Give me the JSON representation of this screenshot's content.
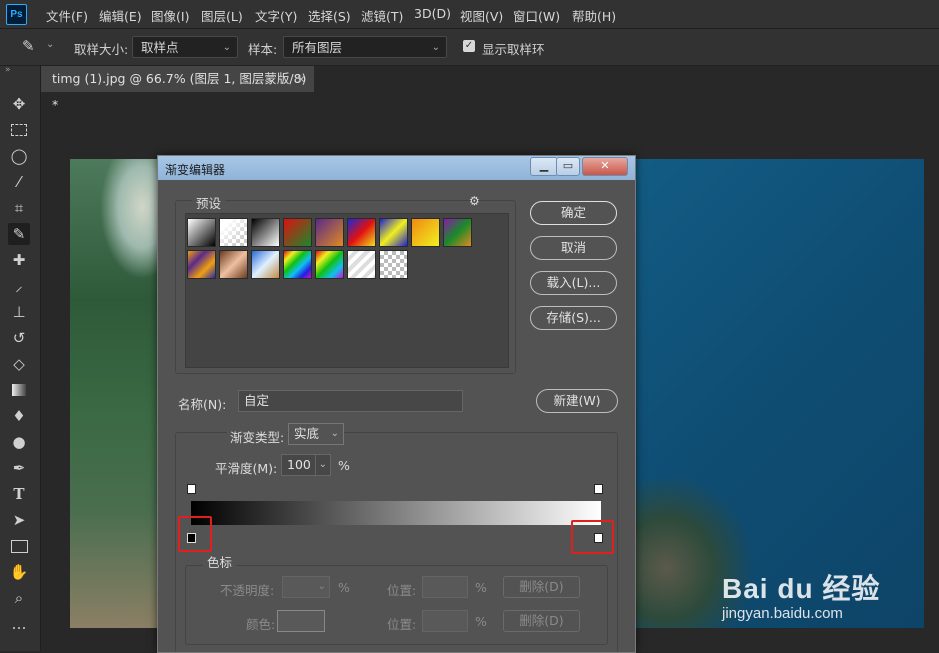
{
  "menu": {
    "logo": "Ps",
    "items": [
      "文件(F)",
      "编辑(E)",
      "图像(I)",
      "图层(L)",
      "文字(Y)",
      "选择(S)",
      "滤镜(T)",
      "3D(D)",
      "视图(V)",
      "窗口(W)",
      "帮助(H)"
    ]
  },
  "options": {
    "sample_size_label": "取样大小:",
    "sample_size_value": "取样点",
    "sample_label": "样本:",
    "sample_value": "所有图层",
    "show_ring_label": "显示取样环",
    "show_ring_checked": true
  },
  "tools": [
    "move-tool",
    "marquee-tool",
    "lasso-tool",
    "magic-wand-tool",
    "crop-tool",
    "eyedropper-tool",
    "healing-brush-tool",
    "brush-tool",
    "stamp-tool",
    "history-brush-tool",
    "eraser-tool",
    "gradient-tool",
    "blur-tool",
    "dodge-tool",
    "pen-tool",
    "type-tool",
    "path-select-tool",
    "rectangle-tool",
    "hand-tool",
    "zoom-tool",
    "more-tools"
  ],
  "active_tool": "eyedropper-tool",
  "document": {
    "tab_title": "timg (1).jpg @ 66.7% (图层 1, 图层蒙版/8) *",
    "close": "×"
  },
  "dialog": {
    "title": "渐变编辑器",
    "presets_label": "预设",
    "buttons": {
      "ok": "确定",
      "cancel": "取消",
      "load": "载入(L)...",
      "save": "存储(S)...",
      "new": "新建(W)"
    },
    "name_label": "名称(N):",
    "name_value": "自定",
    "gradient_type_label": "渐变类型:",
    "gradient_type_value": "实底",
    "smoothness_label": "平滑度(M):",
    "smoothness_value": "100",
    "smoothness_unit": "%",
    "stops_label": "色标",
    "opacity_label": "不透明度:",
    "opacity_unit": "%",
    "location_label": "位置:",
    "location_unit": "%",
    "delete_label": "删除(D)",
    "color_label": "颜色:",
    "gradient_start": "#000000",
    "gradient_end": "#ffffff"
  },
  "watermark": {
    "logo": "Bai du 经验",
    "url": "jingyan.baidu.com"
  }
}
